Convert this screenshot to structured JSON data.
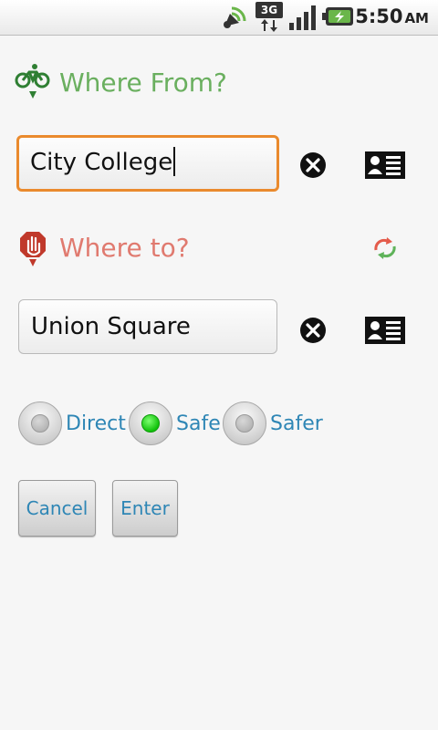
{
  "status_bar": {
    "time": "5:50",
    "ampm": "AM",
    "network_label": "3G",
    "icons": [
      "satellite-icon",
      "network-3g-icon",
      "signal-icon",
      "battery-charging-icon"
    ]
  },
  "from": {
    "label": "Where From?",
    "value": "City College",
    "icon": "bicycle-marker-icon"
  },
  "to": {
    "label": "Where to?",
    "value": "Union Square",
    "icon": "stop-hand-marker-icon"
  },
  "route_options": [
    {
      "label": "Direct",
      "checked": false
    },
    {
      "label": "Safe",
      "checked": true
    },
    {
      "label": "Safer",
      "checked": false
    }
  ],
  "buttons": {
    "cancel": "Cancel",
    "enter": "Enter"
  },
  "colors": {
    "from_green": "#6aaf5f",
    "to_red": "#e07a6f",
    "link_blue": "#2e86b5",
    "focus_orange": "#ea8a2d",
    "radio_checked": "#11c20b"
  }
}
